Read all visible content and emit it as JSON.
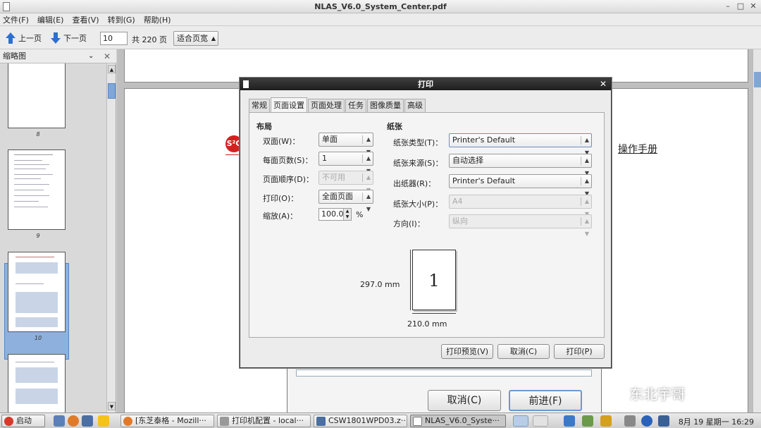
{
  "window": {
    "title": "NLAS_V6.0_System_Center.pdf"
  },
  "menu": [
    "文件(F)",
    "编辑(E)",
    "查看(V)",
    "转到(G)",
    "帮助(H)"
  ],
  "toolbar": {
    "prev_label": "上一页",
    "next_label": "下一页",
    "page_value": "10",
    "page_total": "共 220 页",
    "zoom_value": "适合页宽"
  },
  "sidebar": {
    "title": "缩略图",
    "thumb_labels": [
      "8",
      "9",
      "10"
    ]
  },
  "document": {
    "logo_text": "S²C",
    "heading_fragment": "操作手册",
    "cancel_label": "取消(C)",
    "forward_label": "前进(F)"
  },
  "dialog": {
    "title": "打印",
    "tabs": [
      "常规",
      "页面设置",
      "页面处理",
      "任务",
      "图像质量",
      "高级"
    ],
    "layout": {
      "heading": "布局",
      "duplex_label": "双面(W)：",
      "duplex_value": "单面",
      "pages_per_sheet_label": "每面页数(S)：",
      "pages_per_sheet_value": "1",
      "page_order_label": "页面顺序(D)：",
      "page_order_value": "不可用",
      "print_label": "打印(O)：",
      "print_value": "全面页面",
      "scale_label": "缩放(A)：",
      "scale_value": "100.0",
      "scale_unit": "%"
    },
    "paper": {
      "heading": "纸张",
      "type_label": "纸张类型(T)：",
      "type_value": "Printer's Default",
      "source_label": "纸张来源(S)：",
      "source_value": "自动选择",
      "output_label": "出纸器(R)：",
      "output_value": "Printer's Default",
      "size_label": "纸张大小(P)：",
      "size_value": "A4",
      "orientation_label": "方向(I)：",
      "orientation_value": "纵向"
    },
    "preview": {
      "page_number": "1",
      "height_text": "297.0 mm",
      "width_text": "210.0 mm"
    },
    "buttons": {
      "preview": "打印预览(V)",
      "cancel": "取消(C)",
      "print": "打印(P)"
    }
  },
  "taskbar": {
    "start_label": "启动",
    "tasks": [
      "[东芝泰格 - Mozill···",
      "打印机配置 - local···",
      "CSW1801WPD03.z···",
      "NLAS_V6.0_Syste···"
    ],
    "clock": "8月 19 星期一 16:29"
  },
  "watermark": "东北宇哥"
}
